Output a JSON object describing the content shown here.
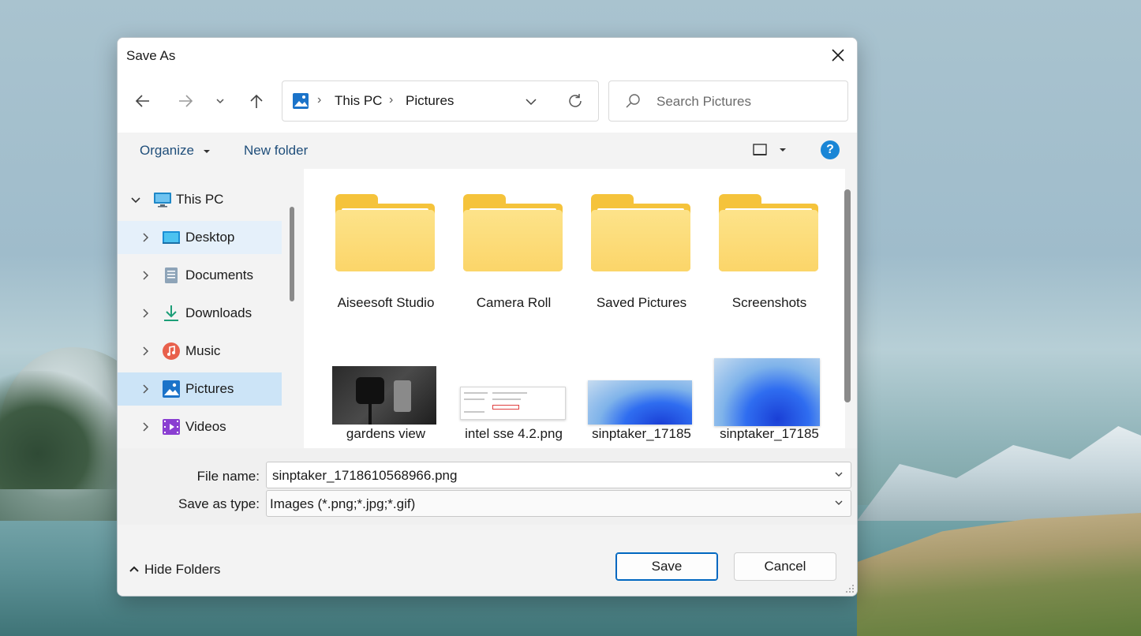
{
  "dialog": {
    "title": "Save As"
  },
  "navigation": {
    "back": "back-arrow",
    "forward": "forward-arrow",
    "recent": "chevron-down",
    "up": "up-arrow",
    "breadcrumb": [
      "This PC",
      "Pictures"
    ],
    "refresh": "refresh"
  },
  "search": {
    "placeholder": "Search Pictures"
  },
  "toolbar": {
    "organize": "Organize",
    "new_folder": "New folder",
    "help": "?"
  },
  "sidebar": {
    "items": [
      {
        "label": "This PC",
        "icon": "monitor"
      },
      {
        "label": "Desktop",
        "icon": "desktop"
      },
      {
        "label": "Documents",
        "icon": "document"
      },
      {
        "label": "Downloads",
        "icon": "download"
      },
      {
        "label": "Music",
        "icon": "music"
      },
      {
        "label": "Pictures",
        "icon": "pictures"
      },
      {
        "label": "Videos",
        "icon": "videos"
      }
    ]
  },
  "content": {
    "folders": [
      "Aiseesoft Studio",
      "Camera Roll",
      "Saved Pictures",
      "Screenshots"
    ],
    "files": [
      "gardens view",
      "intel sse 4.2.png",
      "sinptaker_17185",
      "sinptaker_17185"
    ]
  },
  "footer": {
    "file_name_label": "File name:",
    "file_name_value": "sinptaker_1718610568966.png",
    "save_type_label": "Save as type:",
    "save_type_value": "Images (*.png;*.jpg;*.gif)",
    "hide_folders": "Hide Folders",
    "save": "Save",
    "cancel": "Cancel"
  },
  "colors": {
    "accent": "#0067c0",
    "selection": "#cce4f7",
    "folder": "#f5c33b",
    "help": "#1a86d6"
  }
}
